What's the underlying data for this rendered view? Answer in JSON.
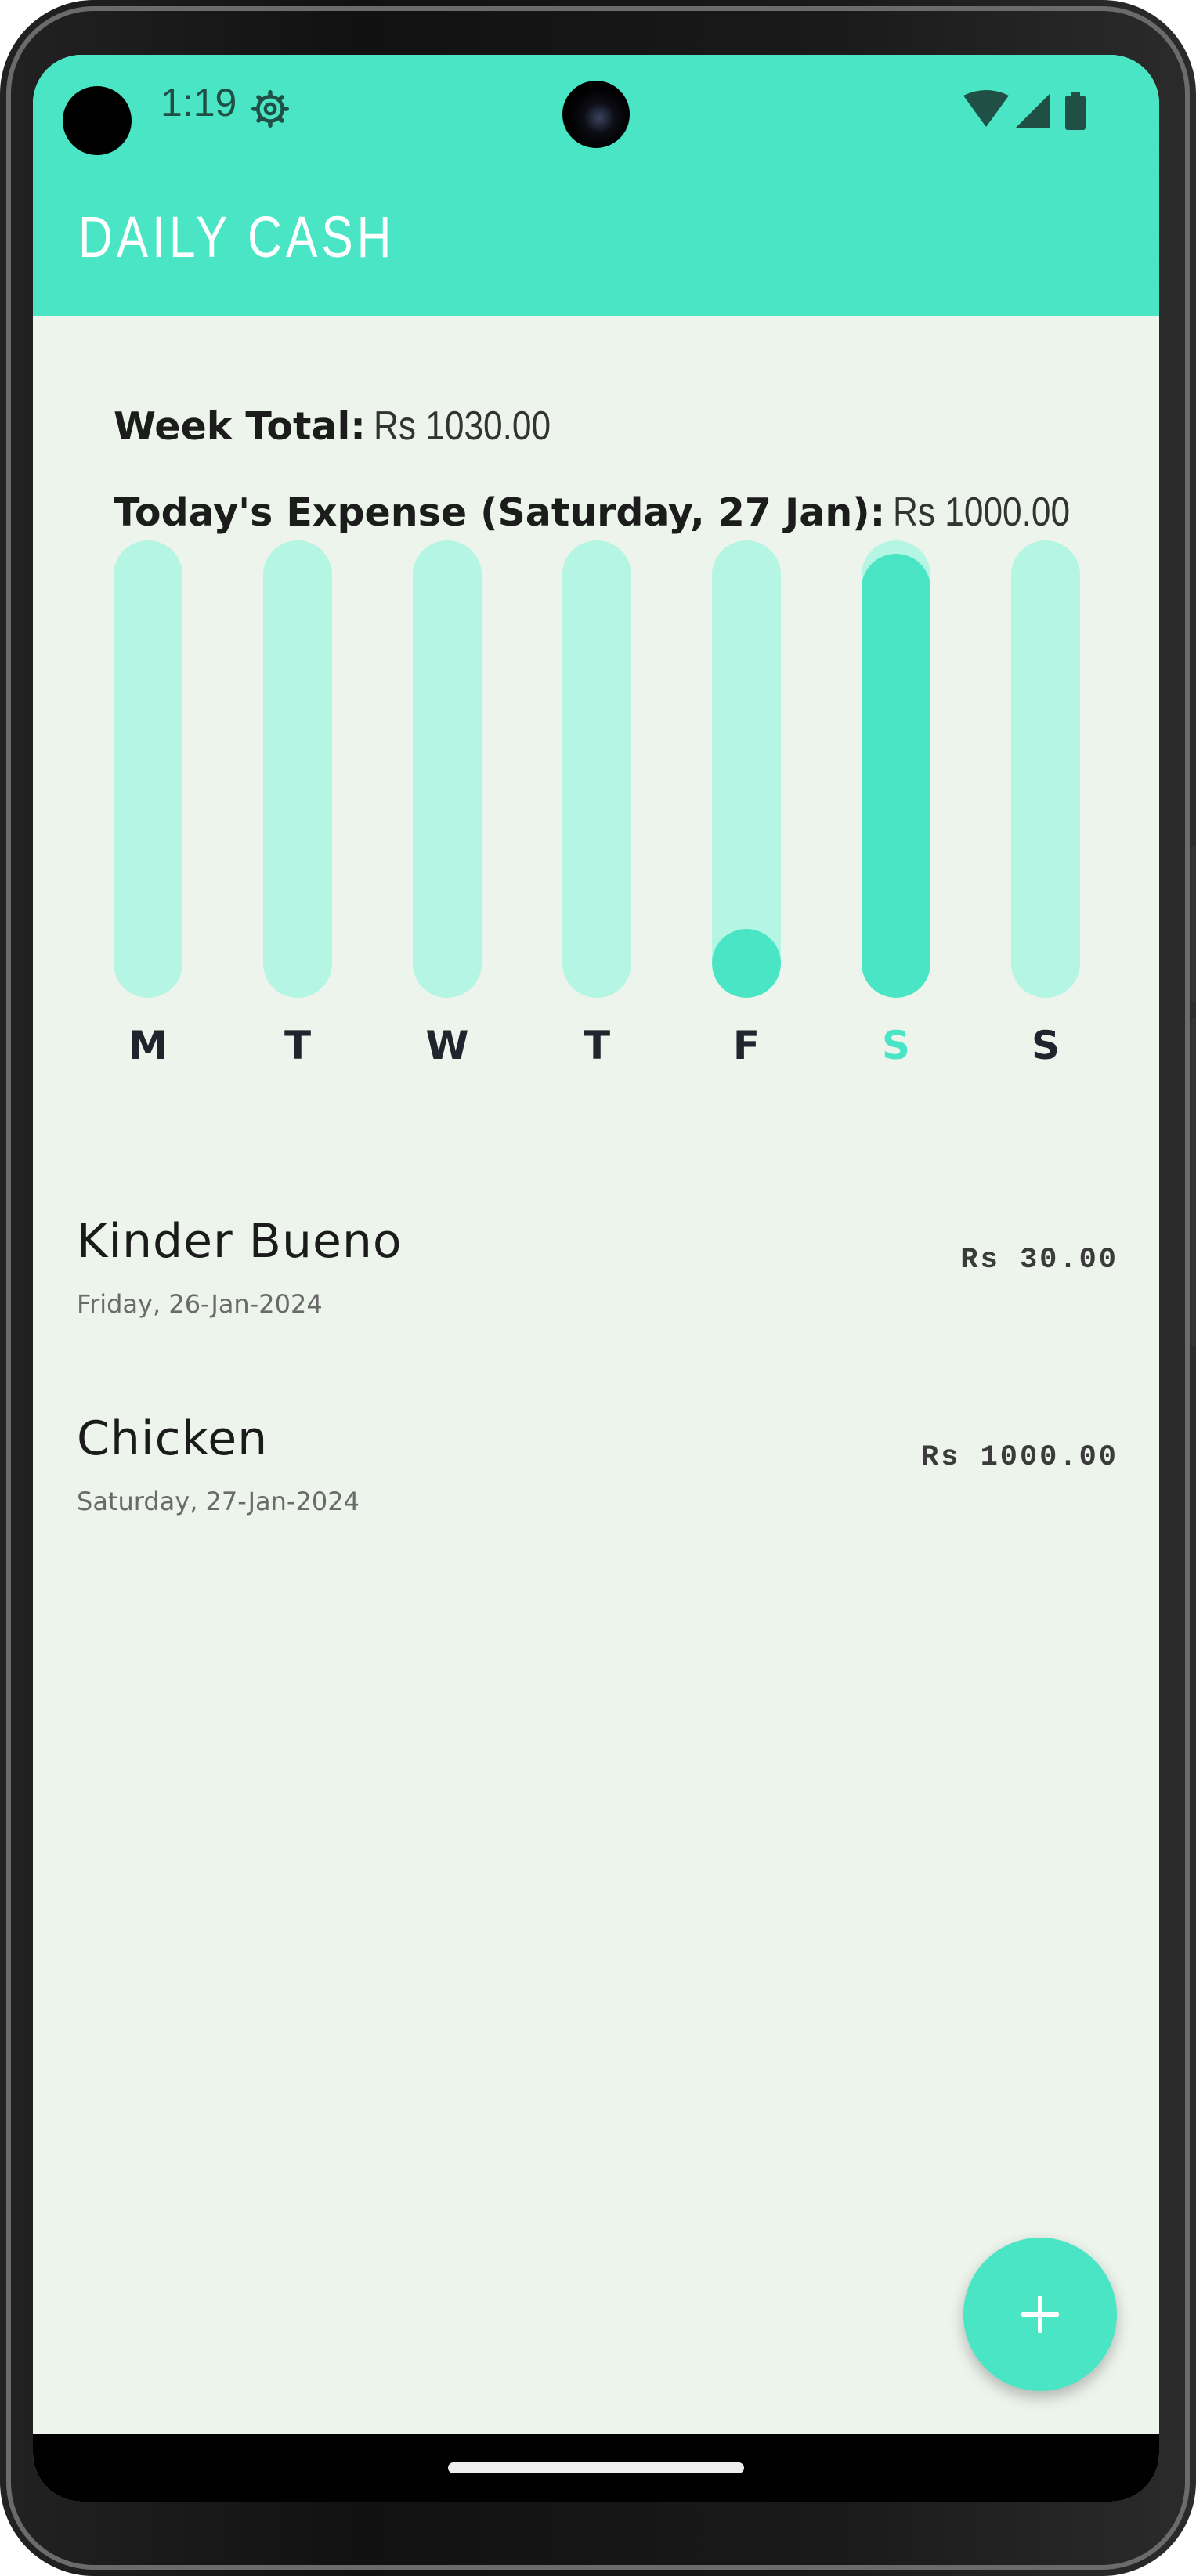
{
  "status_bar": {
    "time": "1:19",
    "icons": [
      "gear-icon",
      "wifi-icon",
      "cellular-icon",
      "battery-icon"
    ]
  },
  "app_bar": {
    "title": "DAILY CASH"
  },
  "summary": {
    "week_total_label": "Week Total:",
    "week_total_value": "Rs 1030.00",
    "today_label": "Today's Expense (Saturday, 27 Jan):",
    "today_value": "Rs 1000.00"
  },
  "colors": {
    "accent": "#4ae5c4",
    "bar_track": "#b4f5e3",
    "background": "#edf4ec"
  },
  "chart_data": {
    "type": "bar",
    "categories": [
      "M",
      "T",
      "W",
      "T",
      "F",
      "S",
      "S"
    ],
    "values": [
      0,
      0,
      0,
      0,
      30,
      1000,
      0
    ],
    "highlighted_index": 5,
    "ylim": [
      0,
      1030
    ]
  },
  "expenses": [
    {
      "title": "Kinder Bueno",
      "date": "Friday, 26-Jan-2024",
      "amount": "Rs 30.00"
    },
    {
      "title": "Chicken",
      "date": "Saturday, 27-Jan-2024",
      "amount": "Rs 1000.00"
    }
  ],
  "fab": {
    "icon": "plus-icon"
  }
}
